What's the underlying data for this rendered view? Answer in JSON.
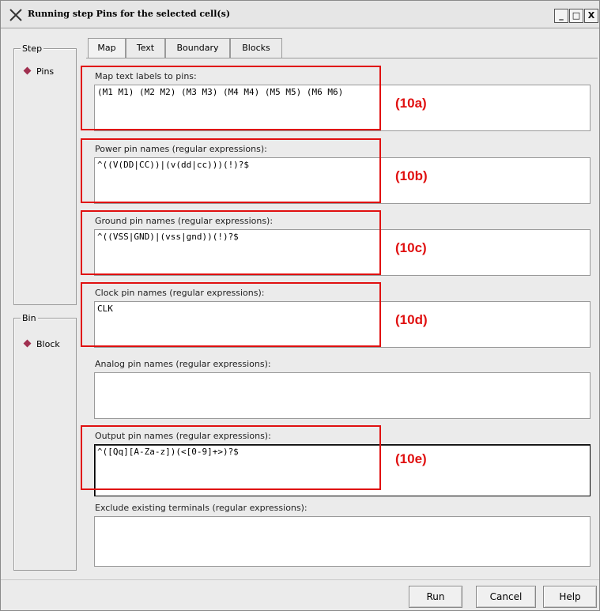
{
  "window": {
    "title": "Running step Pins for the selected cell(s)",
    "controls": [
      "_",
      "□",
      "X"
    ]
  },
  "sidebar": {
    "step": {
      "title": "Step",
      "items": [
        "Pins"
      ]
    },
    "bin": {
      "title": "Bin",
      "items": [
        "Block"
      ]
    }
  },
  "tabs": [
    "Map",
    "Text",
    "Boundary",
    "Blocks"
  ],
  "active_tab": "Map",
  "fields": [
    {
      "label": "Map text labels to pins:",
      "value": "(M1 M1) (M2 M2) (M3 M3) (M4 M4) (M5 M5) (M6 M6)"
    },
    {
      "label": "Power pin names (regular expressions):",
      "value": "^((V(DD|CC))|(v(dd|cc)))(!)?$"
    },
    {
      "label": "Ground pin names (regular expressions):",
      "value": "^((VSS|GND)|(vss|gnd))(!)?$"
    },
    {
      "label": "Clock pin names (regular expressions):",
      "value": "CLK"
    },
    {
      "label": "Analog pin names (regular expressions):",
      "value": ""
    },
    {
      "label": "Output pin names (regular expressions):",
      "value": "^([Qq][A-Za-z])(<[0-9]+>)?$"
    },
    {
      "label": "Exclude existing terminals (regular expressions):",
      "value": ""
    }
  ],
  "annotations": [
    "(10a)",
    "(10b)",
    "(10c)",
    "(10d)",
    "(10e)"
  ],
  "annotation_color": "#e01010",
  "buttons": {
    "run": "Run",
    "cancel": "Cancel",
    "help": "Help"
  }
}
